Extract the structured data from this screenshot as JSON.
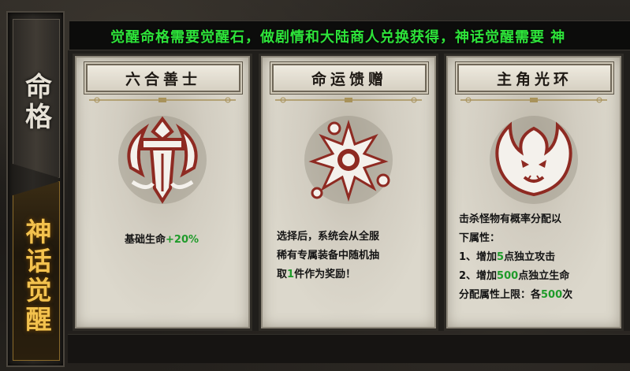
{
  "nav": {
    "tabs": [
      {
        "label": "命格",
        "active": false
      },
      {
        "label": "神话觉醒",
        "active": true
      }
    ]
  },
  "notice": {
    "text": "觉醒命格需要觉醒石，做剧情和大陆商人兑换获得，神话觉醒需要 神"
  },
  "cards": [
    {
      "title": "六合善士",
      "icon": "sword-shield-icon",
      "lines": [
        {
          "parts": [
            {
              "text": "基础生命",
              "green": false
            },
            {
              "text": "+20%",
              "green": true
            }
          ]
        }
      ]
    },
    {
      "title": "命运馈赠",
      "icon": "spiked-orb-icon",
      "lines": [
        {
          "parts": [
            {
              "text": "选择后，系统会从全服",
              "green": false
            }
          ]
        },
        {
          "parts": [
            {
              "text": "稀有专属装备中随机抽",
              "green": false
            }
          ]
        },
        {
          "parts": [
            {
              "text": "取",
              "green": false
            },
            {
              "text": "1",
              "green": true
            },
            {
              "text": "件作为奖励！",
              "green": false
            }
          ]
        }
      ]
    },
    {
      "title": "主角光环",
      "icon": "dragon-head-icon",
      "lines": [
        {
          "parts": [
            {
              "text": "击杀怪物有概率分配以",
              "green": false
            }
          ]
        },
        {
          "parts": [
            {
              "text": "下属性：",
              "green": false
            }
          ]
        },
        {
          "parts": [
            {
              "text": "1、增加",
              "green": false
            },
            {
              "text": "5",
              "green": true
            },
            {
              "text": "点独立攻击",
              "green": false
            }
          ]
        },
        {
          "parts": [
            {
              "text": "2、增加",
              "green": false
            },
            {
              "text": "500",
              "green": true
            },
            {
              "text": "点独立生命",
              "green": false
            }
          ]
        },
        {
          "parts": [
            {
              "text": "分配属性上限：各",
              "green": false
            },
            {
              "text": "500",
              "green": true
            },
            {
              "text": "次",
              "green": false
            }
          ]
        }
      ]
    }
  ],
  "colors": {
    "highlight_green": "#1f9b2a",
    "notice_green": "#2ee33a",
    "active_tab_gold": "#f3c24e",
    "emblem_red": "#8e2a22"
  }
}
